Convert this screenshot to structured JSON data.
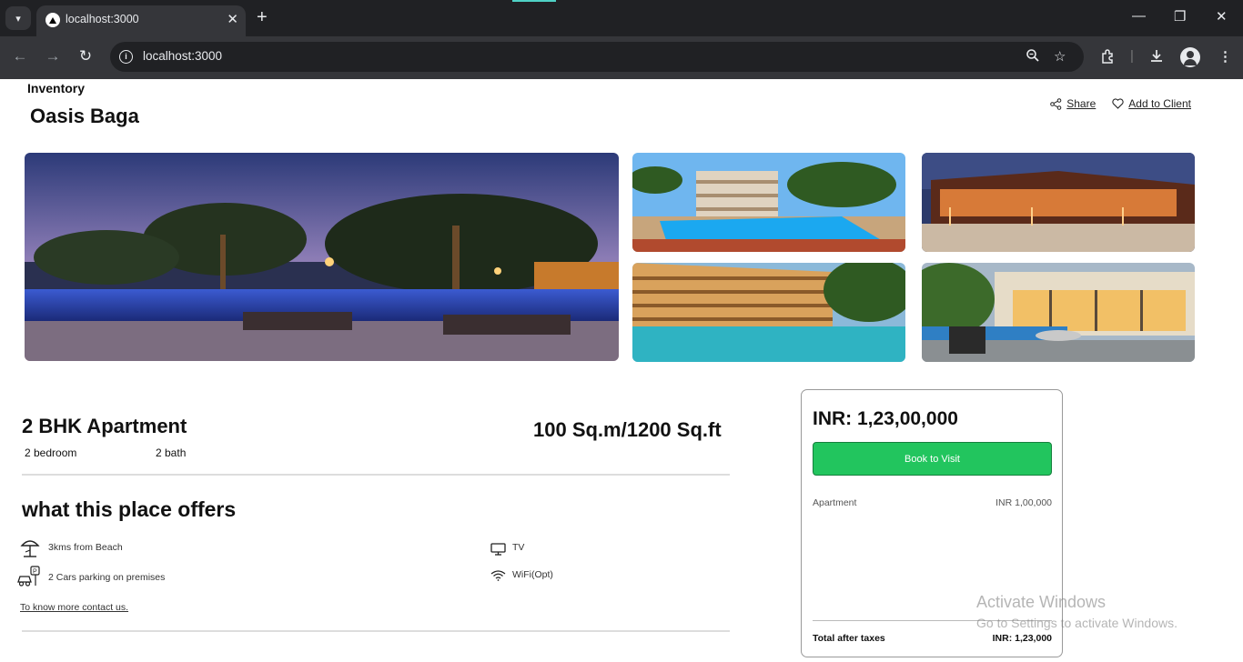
{
  "browser": {
    "tab_title": "localhost:3000",
    "url": "localhost:3000",
    "new_tab_symbol": "+",
    "tab_close_symbol": "✕"
  },
  "page": {
    "breadcrumb": "Inventory",
    "title": "Oasis Baga",
    "share_label": "Share",
    "add_to_client_label": "Add to Client"
  },
  "apartment": {
    "type": "2 BHK Apartment",
    "bedrooms": "2 bedroom",
    "baths": "2 bath",
    "area": "100 Sq.m/1200 Sq.ft"
  },
  "offers": {
    "title": "what this place offers",
    "items": [
      {
        "label": "3kms from Beach",
        "icon": "beach-umbrella-icon"
      },
      {
        "label": "2 Cars parking on premises",
        "icon": "car-parking-icon"
      },
      {
        "label": "TV",
        "icon": "tv-icon"
      },
      {
        "label": "WiFi(Opt)",
        "icon": "wifi-icon"
      }
    ],
    "know_more": "To know more contact us."
  },
  "booking": {
    "price": "INR: 1,23,00,000",
    "book_label": "Book to Visit",
    "line_item_label": "Apartment",
    "line_item_value": "INR 1,00,000",
    "total_label": "Total after taxes",
    "total_value": "INR: 1,23,000"
  },
  "watermark": {
    "line1": "Activate Windows",
    "line2": "Go to Settings to activate Windows."
  },
  "colors": {
    "book_button": "#22c55e",
    "chrome_dark": "#202124",
    "chrome_toolbar": "#35363a"
  }
}
